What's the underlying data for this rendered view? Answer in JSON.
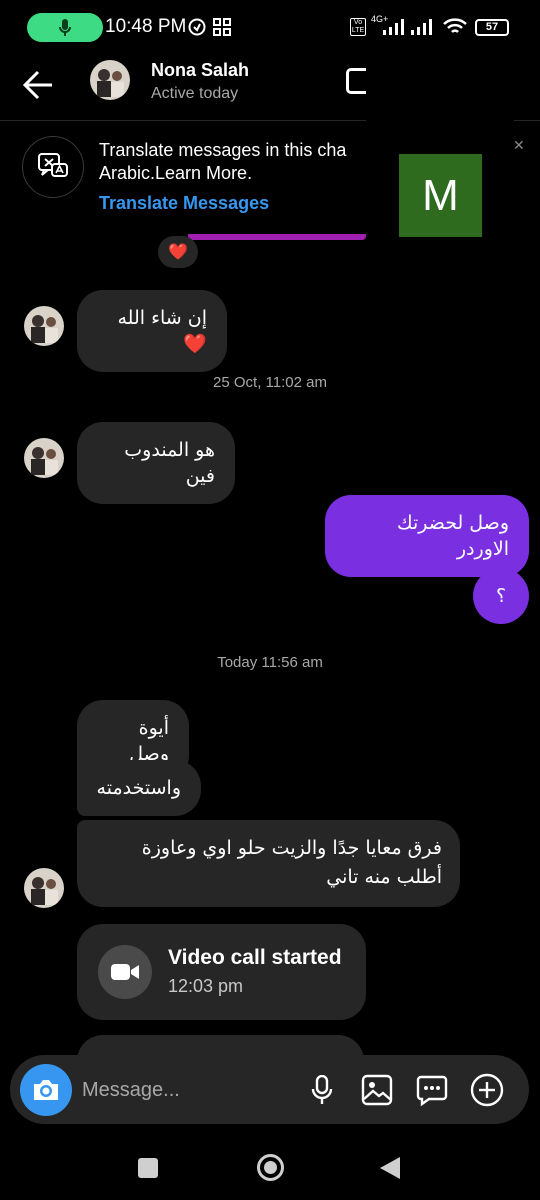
{
  "status_bar": {
    "time": "10:48 PM",
    "battery": "57",
    "network": "4G+",
    "volte": "Vo LTE"
  },
  "header": {
    "contact_name": "Nona Salah",
    "contact_status": "Active today",
    "overlay_letter": "M"
  },
  "translate_banner": {
    "text_line1": "Translate messages in this cha",
    "text_line2": "Arabic.Learn More.",
    "link": "Translate Messages",
    "link_color": "#3797f0"
  },
  "messages": {
    "reaction": "❤️",
    "m1": "إن شاء الله ❤️",
    "ts1": "25 Oct, 11:02 am",
    "m2": "هو المندوب فين",
    "m3": "وصل لحضرتك الاوردر",
    "m4": "؟",
    "ts2": "Today 11:56 am",
    "m5": "أيوة وصل",
    "m6": "واستخدمته",
    "m7": "فرق معايا جدًا والزيت حلو اوي وعاوزة أطلب منه تاني",
    "call_title": "Video call started",
    "call_time": "12:03 pm"
  },
  "composer": {
    "placeholder": "Message...",
    "icons": [
      "camera-icon",
      "mic-icon",
      "gallery-icon",
      "sticker-icon",
      "plus-icon"
    ]
  },
  "colors": {
    "outgoing_bubble": "#7a2fe0",
    "incoming_bubble": "#262626",
    "mic_pill": "#3ddc84"
  }
}
